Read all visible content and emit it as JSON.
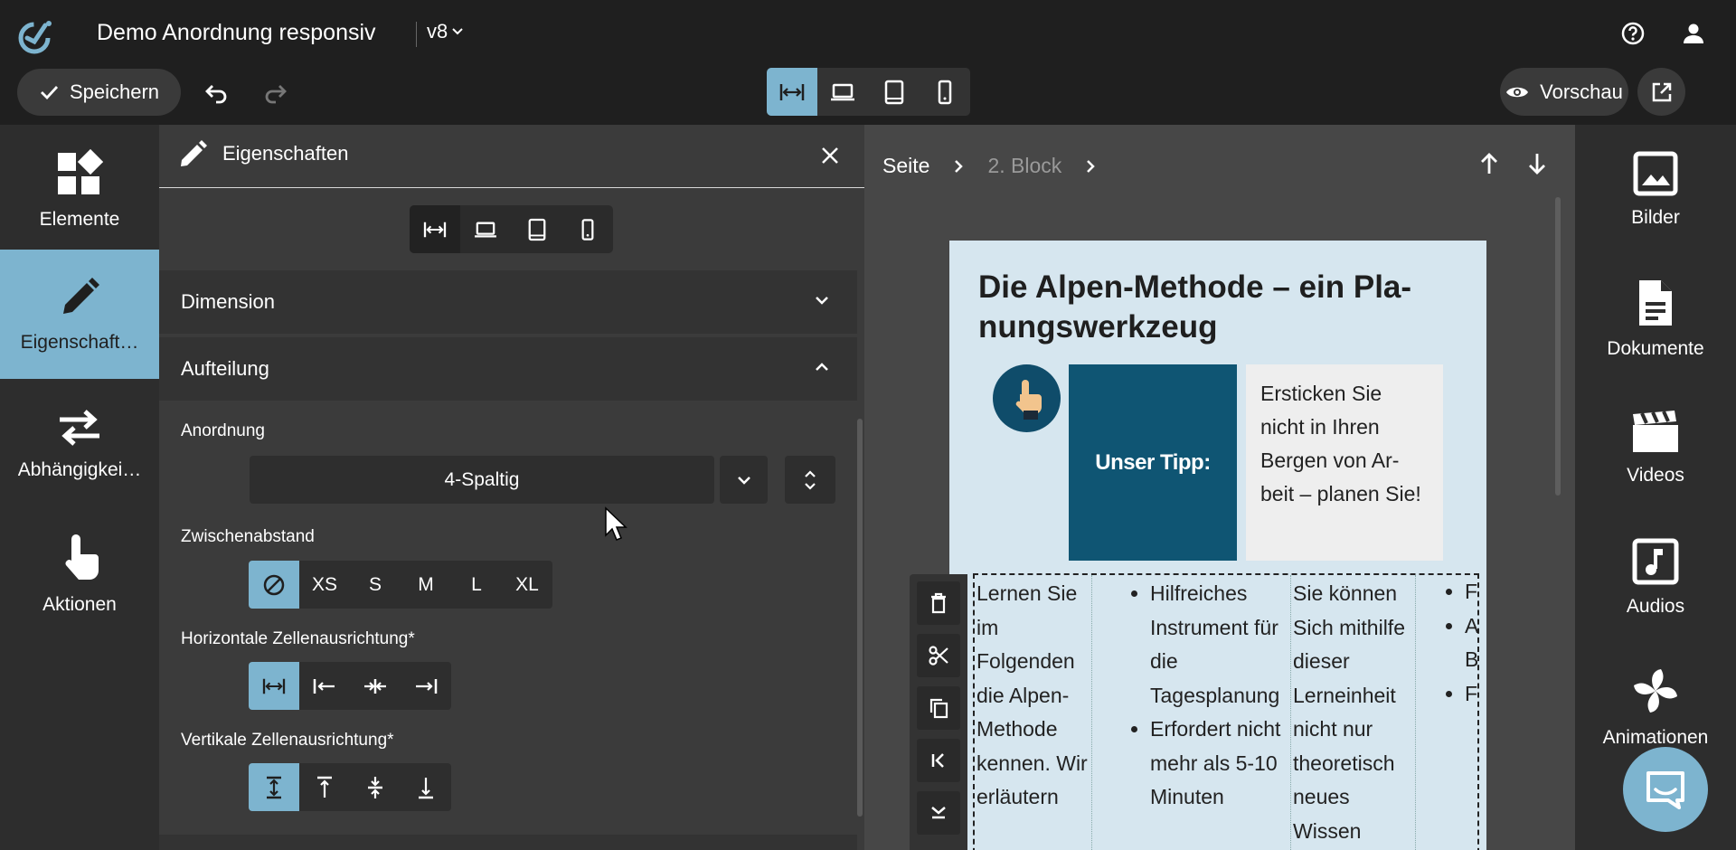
{
  "topbar": {
    "title": "Demo Anordnung responsiv",
    "version": "v8",
    "save_label": "Speichern",
    "preview_label": "Vorschau"
  },
  "left_sidebar": {
    "items": [
      {
        "label": "Elemente",
        "icon": "widgets-icon"
      },
      {
        "label": "Eigenschaft…",
        "icon": "pencil-icon",
        "active": true
      },
      {
        "label": "Abhängigkei…",
        "icon": "swap-icon"
      },
      {
        "label": "Aktionen",
        "icon": "touch-icon"
      }
    ]
  },
  "properties": {
    "title": "Eigenschaften",
    "sections": {
      "dimension": "Dimension",
      "aufteilung": "Aufteilung"
    },
    "anordnung_label": "Anordnung",
    "anordnung_value": "4-Spaltig",
    "zwischenabstand_label": "Zwischenabstand",
    "spacing_options": [
      "",
      "XS",
      "S",
      "M",
      "L",
      "XL"
    ],
    "horizontal_label": "Horizontale Zellenausrichtung*",
    "vertical_label": "Vertikale Zellenausrichtung*"
  },
  "canvas": {
    "breadcrumb": [
      "Seite",
      "2. Block"
    ],
    "heading": "Die Alpen-Methode – ein Pla-nungswerkzeug",
    "tip_label": "Unser Tipp:",
    "tip_text": "Ersticken Sie nicht in Ihren Bergen von Ar-beit – planen Sie!",
    "col1": "Lernen Sie im Folgenden die Alpen-Methode kennen. Wir erläutern",
    "col2_items": [
      "Hilfreiches Instrument für die Tagesplanung",
      "Erfordert nicht mehr als 5-10 Minuten"
    ],
    "col3": "Sie können Sich mithilfe dieser Lerneinheit nicht nur theoretisch neues Wissen",
    "col4_items": [
      "F",
      "A",
      "B",
      "F"
    ]
  },
  "right_sidebar": {
    "items": [
      "Bilder",
      "Dokumente",
      "Videos",
      "Audios",
      "Animationen"
    ]
  },
  "colors": {
    "accent": "#7db4cf",
    "tip_dark": "#0f5573",
    "page_bg": "#d6e6ef"
  }
}
